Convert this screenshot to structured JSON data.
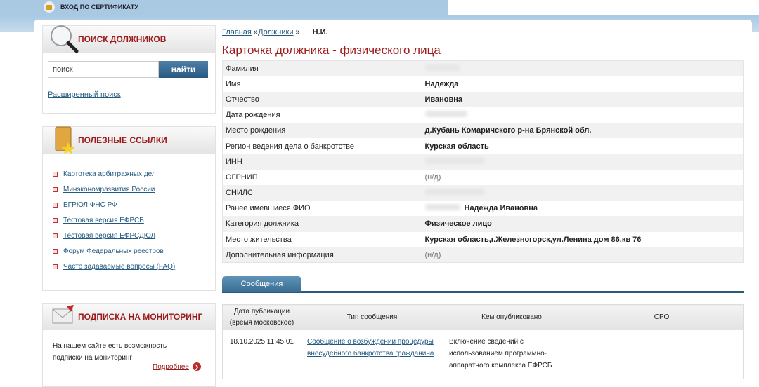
{
  "topbar": {
    "cert_login": "ВХОД ПО СЕРТИФИКАТУ"
  },
  "search": {
    "title": "ПОИСК ДОЛЖНИКОВ",
    "value": "поиск",
    "button": "найти",
    "advanced": "Расширенный поиск"
  },
  "links": {
    "title": "ПОЛЕЗНЫЕ ССЫЛКИ",
    "items": [
      "Картотека арбитражных дел",
      "Минэкономразвития России",
      "ЕГРЮЛ ФНС РФ",
      "Тестовая версия ЕФРСБ",
      "Тестовая версия ЕФРСДЮЛ",
      "Форум Федеральных реестров",
      "Часто задаваемые вопросы (FAQ)"
    ]
  },
  "subscription": {
    "title": "ПОДПИСКА НА МОНИТОРИНГ",
    "text1": "На нашем сайте есть возможность",
    "text2": "подписки на мониторинг",
    "more": "Подробнее"
  },
  "breadcrumb": {
    "home": "Главная",
    "sep1": " »",
    "debtors": "Должники",
    "sep2": " »",
    "name": "Н.И."
  },
  "page_title": "Карточка должника - физического лица",
  "info": [
    {
      "label": "Фамилия",
      "value": ""
    },
    {
      "label": "Имя",
      "value": "Надежда"
    },
    {
      "label": "Отчество",
      "value": "Ивановна"
    },
    {
      "label": "Дата рождения",
      "value": ""
    },
    {
      "label": "Место рождения",
      "value": "д.Кубань Комаричского р-на Брянской обл."
    },
    {
      "label": "Регион ведения дела о банкротстве",
      "value": "Курская область"
    },
    {
      "label": "ИНН",
      "value": ""
    },
    {
      "label": "ОГРНИП",
      "value": "(н/д)"
    },
    {
      "label": "СНИЛС",
      "value": ""
    },
    {
      "label": "Ранее имевшиеся ФИО",
      "value": "Надежда Ивановна"
    },
    {
      "label": "Категория должника",
      "value": "Физическое лицо"
    },
    {
      "label": "Место жительства",
      "value": "Курская область,г.Железногорск,ул.Ленина дом 86,кв 76"
    },
    {
      "label": "Дополнительная информация",
      "value": "(н/д)"
    }
  ],
  "tab": "Сообщения",
  "messages": {
    "headers": {
      "date1": "Дата публикации",
      "date2": "(время московское)",
      "type": "Тип сообщения",
      "by": "Кем опубликовано",
      "sro": "СРО"
    },
    "rows": [
      {
        "date": "18.10.2025 11:45:01",
        "type": "Сообщение о возбуждении процедуры внесудебного банкротства гражданина",
        "by": "Включение сведений с использованием программно-аппаратного комплекса ЕФРСБ",
        "sro": ""
      }
    ]
  }
}
